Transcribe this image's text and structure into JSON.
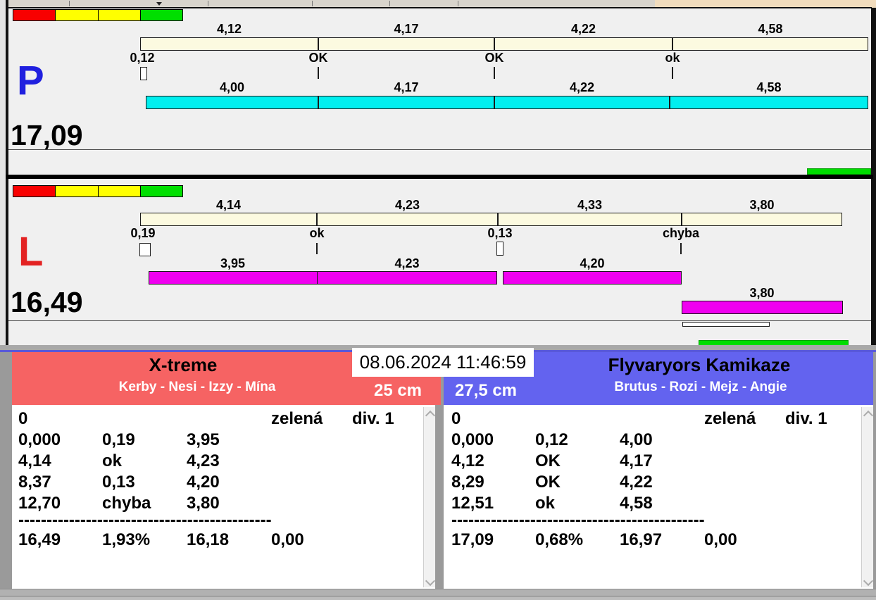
{
  "app": {
    "datetime": "08.06.2024 11:46:59"
  },
  "lanes": [
    {
      "label": "P",
      "total": "17,09",
      "upper_labels": [
        "4,12",
        "4,17",
        "4,22",
        "4,58"
      ],
      "marks": [
        "0,12",
        "OK",
        "OK",
        "ok"
      ],
      "lower_labels": [
        "4,00",
        "4,17",
        "4,22",
        "4,58"
      ]
    },
    {
      "label": "L",
      "total": "16,49",
      "upper_labels": [
        "4,14",
        "4,23",
        "4,33",
        "3,80"
      ],
      "marks": [
        "0,19",
        "ok",
        "0,13",
        "chyba"
      ],
      "lower_labels": [
        "3,95",
        "4,23",
        "4,20",
        "3,80"
      ]
    }
  ],
  "teams": {
    "left": {
      "name": "X-treme",
      "members": "Kerby - Nesi - Izzy - Mína",
      "jump_height": "25 cm",
      "rows": [
        [
          "0",
          "",
          "",
          "zelená",
          "div. 1"
        ],
        [
          "0,000",
          "0,19",
          "3,95",
          "",
          ""
        ],
        [
          "4,14",
          "ok",
          "4,23",
          "",
          ""
        ],
        [
          "8,37",
          "0,13",
          "4,20",
          "",
          ""
        ],
        [
          "12,70",
          "chyba",
          "3,80",
          "",
          ""
        ]
      ],
      "separator": "---------------------------------------------",
      "totals": [
        "16,49",
        "1,93%",
        "16,18",
        "0,00"
      ]
    },
    "right": {
      "name": "Flyvaryors Kamikaze",
      "members": "Brutus - Rozi - Mejz - Angie",
      "jump_height": "27,5 cm",
      "rows": [
        [
          "0",
          "",
          "",
          "zelená",
          "div. 1"
        ],
        [
          "0,000",
          "0,12",
          "4,00",
          "",
          ""
        ],
        [
          "4,12",
          "OK",
          "4,17",
          "",
          ""
        ],
        [
          "8,29",
          "OK",
          "4,22",
          "",
          ""
        ],
        [
          "12,51",
          "ok",
          "4,58",
          "",
          ""
        ]
      ],
      "separator": "---------------------------------------------",
      "totals": [
        "17,09",
        "0,68%",
        "16,97",
        "0,00"
      ]
    }
  },
  "colors": {
    "lane_bg": "#F0F0F0",
    "split_bar": "#FCFAE0",
    "right_dog_bar": "#00EFEF",
    "left_dog_bar": "#F000F0",
    "strip_red": "#F80000",
    "strip_yellow": "#FFFF00",
    "strip_green": "#00DF00",
    "green_indicator": "#00DC00",
    "p_letter": "#2020DF",
    "l_letter": "#E32222",
    "team_left_header": "#F66363",
    "team_right_header": "#6363EF",
    "toolbar_tan": "#F1DCBD",
    "panel_gray": "#9A9A9A",
    "accent_line": "#5959D9"
  }
}
